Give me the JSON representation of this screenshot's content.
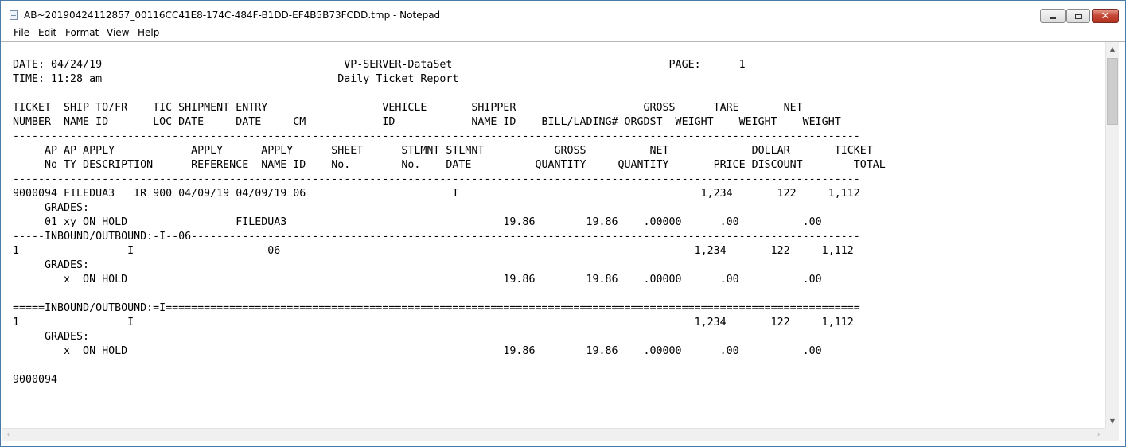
{
  "window": {
    "title": "AB~20190424112857_00116CC41E8-174C-484F-B1DD-EF4B5B73FCDD.tmp - Notepad",
    "icons": {
      "app": "notepad-icon",
      "minimize": "minimize-icon",
      "maximize": "maximize-icon",
      "close": "close-icon"
    },
    "close_glyph": "✕"
  },
  "menu": {
    "file": "File",
    "edit": "Edit",
    "format": "Format",
    "view": "View",
    "help": "Help"
  },
  "document": {
    "text": "DATE: 04/24/19                                      VP-SERVER-DataSet                                  PAGE:      1\nTIME: 11:28 am                                     Daily Ticket Report\n\nTICKET  SHIP TO/FR    TIC SHIPMENT ENTRY                  VEHICLE       SHIPPER                    GROSS      TARE       NET\nNUMBER  NAME ID       LOC DATE     DATE     CM            ID            NAME ID    BILL/LADING# ORGDST  WEIGHT    WEIGHT    WEIGHT\n-------------------------------------------------------------------------------------------------------------------------------------\n     AP AP APPLY            APPLY      APPLY      SHEET      STLMNT STLMNT           GROSS          NET             DOLLAR       TICKET\n     No TY DESCRIPTION      REFERENCE  NAME ID    No.        No.    DATE          QUANTITY     QUANTITY       PRICE DISCOUNT        TOTAL\n-------------------------------------------------------------------------------------------------------------------------------------\n9000094 FILEDUA3   IR 900 04/09/19 04/09/19 06                       T                                      1,234       122     1,112\n     GRADES:\n     01 xy ON HOLD                 FILEDUA3                                  19.86        19.86    .00000      .00          .00\n-----INBOUND/OUTBOUND:-I--06---------------------------------------------------------------------------------------------------------\n1                 I                     06                                                                 1,234       122     1,112\n     GRADES:\n        x  ON HOLD                                                           19.86        19.86    .00000      .00          .00\n\n=====INBOUND/OUTBOUND:=I=============================================================================================================\n1                 I                                                                                        1,234       122     1,112\n     GRADES:\n        x  ON HOLD                                                           19.86        19.86    .00000      .00          .00\n\n9000094"
  },
  "scrollbars": {
    "up_arrow": "▲",
    "down_arrow": "▼",
    "left_arrow": "‹",
    "right_arrow": "›",
    "icons": {
      "up": "arrow-up-icon",
      "down": "arrow-down-icon",
      "left": "arrow-left-icon",
      "right": "arrow-right-icon"
    }
  },
  "colors": {
    "window_border": "#4a7aa8",
    "close_button": "#c74a38",
    "text": "#000000"
  }
}
